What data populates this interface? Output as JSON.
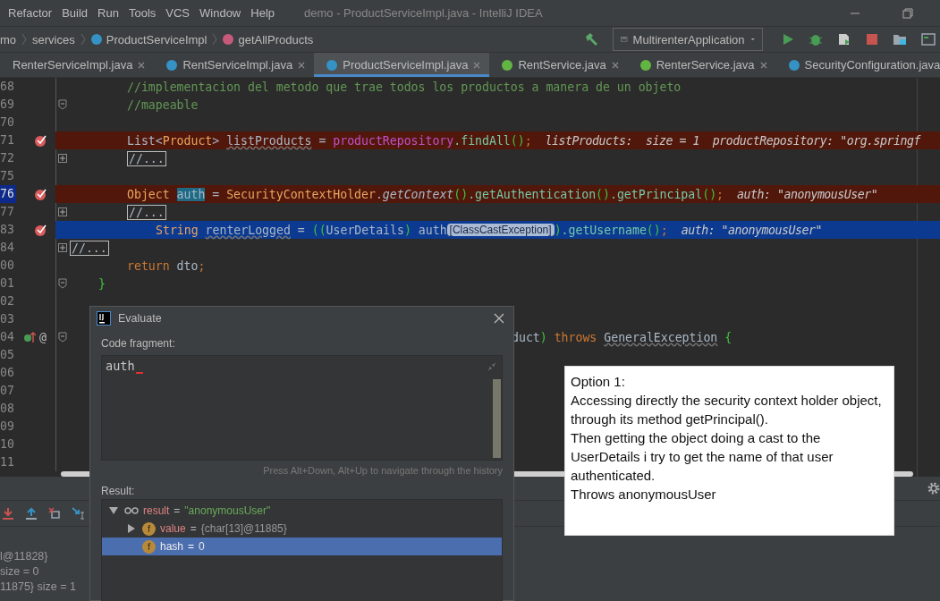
{
  "menu": [
    "Refactor",
    "Build",
    "Run",
    "Tools",
    "VCS",
    "Window",
    "Help"
  ],
  "window": {
    "title": "demo - ProductServiceImpl.java - IntelliJ IDEA"
  },
  "breadcrumb": [
    {
      "text": "mo",
      "kind": "plain"
    },
    {
      "text": "services",
      "kind": "plain"
    },
    {
      "text": "ProductServiceImpl",
      "kind": "class"
    },
    {
      "text": "getAllProducts",
      "kind": "method"
    }
  ],
  "run_config": {
    "label": "MultirenterApplication"
  },
  "tabs": [
    {
      "label": "RenterServiceImpl.java",
      "kind": "plain",
      "selected": false
    },
    {
      "label": "RentServiceImpl.java",
      "kind": "class",
      "selected": false
    },
    {
      "label": "ProductServiceImpl.java",
      "kind": "class",
      "selected": true
    },
    {
      "label": "RentService.java",
      "kind": "interface",
      "selected": false
    },
    {
      "label": "RenterService.java",
      "kind": "interface",
      "selected": false
    },
    {
      "label": "SecurityConfiguration.java",
      "kind": "class",
      "selected": false
    }
  ],
  "code_lines": [
    {
      "number": "68",
      "kind": "base",
      "breakpoint": false,
      "execution": false,
      "selected": false,
      "segments": [
        {
          "text": "//implementacion del metodo que trae todos los productos a manera de un objeto",
          "kind": "comment"
        }
      ]
    },
    {
      "number": "69",
      "kind": "base",
      "breakpoint": false,
      "execution": false,
      "selected": false,
      "expanded": true,
      "segments": [
        {
          "text": "//mapeable",
          "kind": "comment"
        }
      ]
    },
    {
      "number": "70",
      "kind": "base",
      "breakpoint": false,
      "execution": false,
      "selected": false
    },
    {
      "number": "71",
      "kind": "base",
      "breakpoint": true,
      "execution": false,
      "selected": false,
      "segments": [
        {
          "text": "List<",
          "kind": "plain"
        },
        {
          "text": "Product",
          "kind": "type"
        },
        {
          "text": "> ",
          "kind": "plain"
        },
        {
          "text": "listProducts",
          "kind": "var"
        },
        {
          "text": " = ",
          "kind": "plain"
        },
        {
          "text": "productRepository",
          "kind": "field"
        },
        {
          "text": ".findAll",
          "kind": "call"
        },
        {
          "text": "()",
          "kind": "paren"
        },
        {
          "text": ";",
          "kind": "keyword"
        },
        {
          "text": "  listProducts:  size = 1  productRepository: \"org.springf",
          "kind": "hint"
        }
      ]
    },
    {
      "number": "72",
      "kind": "base",
      "breakpoint": false,
      "execution": false,
      "selected": false,
      "expanded": false,
      "segments": [
        {
          "text": "//...",
          "kind": "folded"
        }
      ]
    },
    {
      "number": "75",
      "kind": "base",
      "breakpoint": false,
      "execution": false,
      "selected": false
    },
    {
      "number": "76",
      "kind": "base",
      "breakpoint": true,
      "execution": false,
      "selected": true,
      "segments": [
        {
          "text": "Object ",
          "kind": "type"
        },
        {
          "text": "auth",
          "kind": "highlight"
        },
        {
          "text": " = ",
          "kind": "plain"
        },
        {
          "text": "SecurityContextHolder",
          "kind": "type"
        },
        {
          "text": ".",
          "kind": "plain"
        },
        {
          "text": "getContext",
          "kind": "static"
        },
        {
          "text": "()",
          "kind": "paren"
        },
        {
          "text": ".getAuthentication",
          "kind": "call"
        },
        {
          "text": "()",
          "kind": "paren"
        },
        {
          "text": ".getPrincipal",
          "kind": "call"
        },
        {
          "text": "()",
          "kind": "paren"
        },
        {
          "text": ";",
          "kind": "keyword"
        },
        {
          "text": "  auth: \"anonymousUser\"",
          "kind": "hint"
        }
      ]
    },
    {
      "number": "77",
      "kind": "base",
      "breakpoint": false,
      "execution": false,
      "selected": false,
      "expanded": false,
      "segments": [
        {
          "text": "//...",
          "kind": "folded"
        }
      ]
    },
    {
      "number": "83",
      "kind": "deep",
      "breakpoint": true,
      "execution": true,
      "selected": false,
      "segments": [
        {
          "text": "String ",
          "kind": "type"
        },
        {
          "text": "renterLogged",
          "kind": "var"
        },
        {
          "text": " = ",
          "kind": "plain"
        },
        {
          "text": "((",
          "kind": "paren"
        },
        {
          "text": "UserDetails",
          "kind": "plain"
        },
        {
          "text": ") ",
          "kind": "paren"
        },
        {
          "text": "auth",
          "kind": "plain"
        },
        {
          "text": "[ClassCastException]",
          "kind": "badge"
        },
        {
          "text": ")",
          "kind": "paren"
        },
        {
          "text": ".getUsername",
          "kind": "call"
        },
        {
          "text": "()",
          "kind": "paren"
        },
        {
          "text": ";",
          "kind": "keyword"
        },
        {
          "text": "  auth: \"anonymousUser\"",
          "kind": "hint"
        }
      ]
    },
    {
      "number": "84",
      "kind": "edge",
      "breakpoint": false,
      "execution": false,
      "selected": false,
      "expanded": false,
      "segments": [
        {
          "text": "//...",
          "kind": "folded"
        }
      ]
    },
    {
      "number": "00",
      "kind": "base",
      "breakpoint": false,
      "execution": false,
      "selected": false,
      "segments": [
        {
          "text": "return ",
          "kind": "keyword"
        },
        {
          "text": "dto",
          "kind": "plain"
        },
        {
          "text": ";",
          "kind": "keyword"
        }
      ]
    },
    {
      "number": "01",
      "kind": "brace",
      "breakpoint": false,
      "execution": false,
      "selected": false,
      "expanded": true,
      "segments": [
        {
          "text": "}",
          "kind": "paren"
        }
      ]
    },
    {
      "number": "02",
      "kind": "base",
      "breakpoint": false,
      "execution": false,
      "selected": false
    },
    {
      "number": "03",
      "kind": "base",
      "breakpoint": false,
      "execution": false,
      "selected": false
    },
    {
      "number": "04",
      "kind": "covered",
      "breakpoint": false,
      "execution": false,
      "selected": false,
      "expanded": true,
      "annotation": "@",
      "segments": [
        {
          "text": "duct",
          "kind": "plain"
        },
        {
          "text": ")",
          "kind": "paren"
        },
        {
          "text": " throws ",
          "kind": "keyword"
        },
        {
          "text": "GeneralException",
          "kind": "var"
        },
        {
          "text": " {",
          "kind": "paren"
        }
      ]
    },
    {
      "number": "05",
      "kind": "base",
      "breakpoint": false,
      "execution": false,
      "selected": false
    },
    {
      "number": "06",
      "kind": "base",
      "breakpoint": false,
      "execution": false,
      "selected": false
    },
    {
      "number": "07",
      "kind": "base",
      "breakpoint": false,
      "execution": false,
      "selected": false
    },
    {
      "number": "08",
      "kind": "base",
      "breakpoint": false,
      "execution": false,
      "selected": false
    },
    {
      "number": "09",
      "kind": "base",
      "breakpoint": false,
      "execution": false,
      "selected": false
    },
    {
      "number": "10",
      "kind": "base",
      "breakpoint": false,
      "execution": false,
      "selected": false
    },
    {
      "number": "11",
      "kind": "base",
      "breakpoint": false,
      "execution": false,
      "selected": false
    }
  ],
  "variables": [
    "l@11828}",
    "size = 0",
    "11875}  size = 1"
  ],
  "evaluate": {
    "title": "Evaluate",
    "code_label": "Code fragment:",
    "code": "auth",
    "hint": "Press Alt+Down, Alt+Up to navigate through the history",
    "result_label": "Result:",
    "tree": [
      {
        "name": "result",
        "value": "\"anonymousUser\"",
        "kind": "watch",
        "separator": "=",
        "is_string": true,
        "expanded": true,
        "selected": false,
        "children": [
          {
            "name": "value",
            "value": "{char[13]@11885}",
            "kind": "field",
            "icon_text": "f",
            "separator": "=",
            "is_string": false,
            "expanded": false,
            "selected": false
          },
          {
            "name": "hash",
            "value": "0",
            "kind": "field",
            "icon_text": "f",
            "separator": "=",
            "is_string": false,
            "selected": true
          }
        ]
      }
    ]
  },
  "note": {
    "paragraphs": [
      "Option 1:",
      "Accessing directly the security context holder object, through its method getPrincipal().",
      "Then getting the object doing a cast to the UserDetails i try to get the name of that user authenticated.",
      "Throws anonymousUser"
    ]
  }
}
